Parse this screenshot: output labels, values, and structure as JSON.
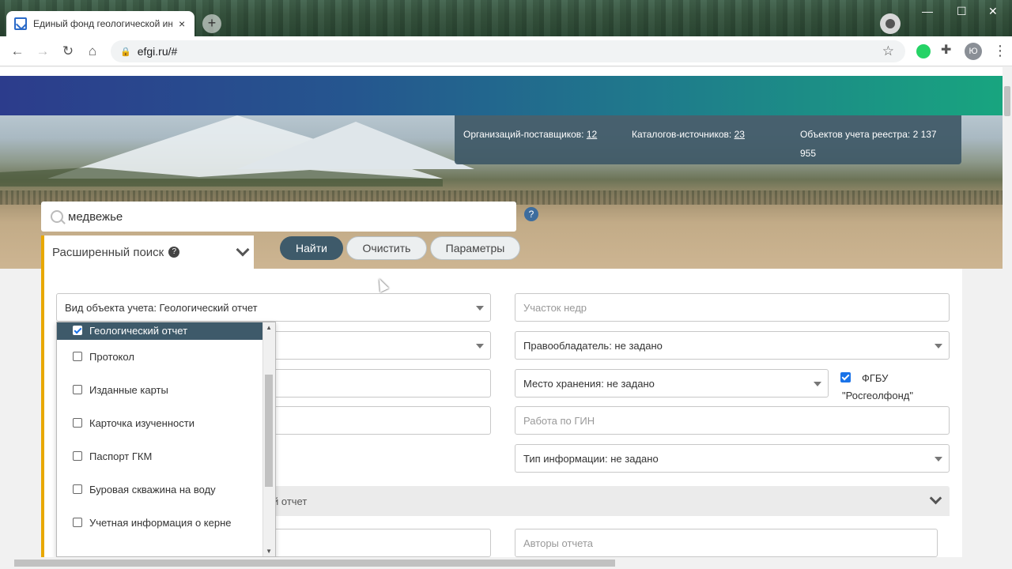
{
  "browser": {
    "tab_title": "Единый фонд геологической ин",
    "tab_close": "×",
    "new_tab": "+",
    "url": "efgi.ru/#",
    "profile_initial": "Ю",
    "window_controls": [
      "—",
      "☐",
      "✕"
    ]
  },
  "stats": {
    "suppliers_label": "Организаций-поставщиков:",
    "suppliers_value": "12",
    "catalogs_label": "Каталогов-источников:",
    "catalogs_value": "23",
    "objects_label": "Объектов учета реестра:",
    "objects_value": "2 137",
    "objects_value_cont": "955"
  },
  "search": {
    "query": "медвежье",
    "help": "?"
  },
  "advanced": {
    "title": "Расширенный поиск",
    "help": "?"
  },
  "buttons": {
    "find": "Найти",
    "clear": "Очистить",
    "params": "Параметры"
  },
  "fields": {
    "object_type": "Вид объекта учета: Геологический отчет",
    "subsoil_plot": "Участок недр",
    "rights_holder": "Правообладатель: не задано",
    "storage_place": "Место хранения: не задано",
    "gin_work": "Работа по ГИН",
    "info_type": "Тип информации: не задано",
    "report_authors": "Авторы отчета",
    "fgbu_label": "ФГБУ",
    "fgbu_label2": "\"Росгеолфонд\""
  },
  "section": {
    "label": "й отчет"
  },
  "dropdown": {
    "options": [
      {
        "label": "Геологический отчет",
        "checked": true
      },
      {
        "label": "Протокол",
        "checked": false
      },
      {
        "label": "Изданные карты",
        "checked": false
      },
      {
        "label": "Карточка изученности",
        "checked": false
      },
      {
        "label": "Паспорт ГКМ",
        "checked": false
      },
      {
        "label": "Буровая скважина на воду",
        "checked": false
      },
      {
        "label": "Учетная информация о керне",
        "checked": false
      }
    ]
  },
  "colors": {
    "accent": "#3e5a6a",
    "highlight_border": "#e8a800",
    "banner_start": "#2c3c8c",
    "banner_end": "#18a57f"
  }
}
